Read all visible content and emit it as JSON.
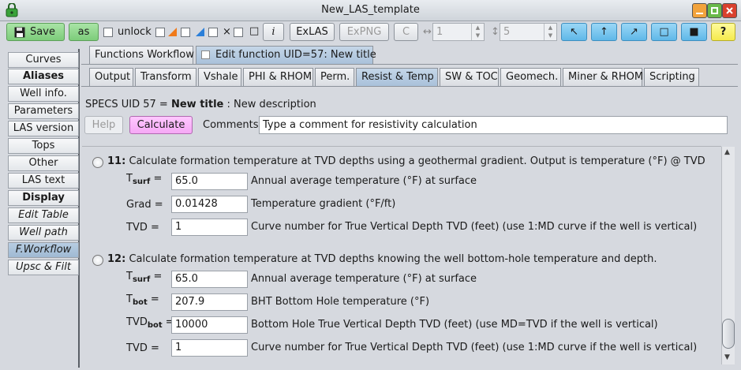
{
  "window": {
    "title": "New_LAS_template"
  },
  "toolbar": {
    "save_label": "Save",
    "as_label": "as",
    "unlock_label": "unlock",
    "x_label": "×",
    "info_label": "i",
    "exlas_label": "ExLAS",
    "expng_label": "ExPNG",
    "c_label": "C",
    "width_value": "1",
    "height_value": "5",
    "arrow_nw": "↖",
    "arrow_up": "↑",
    "arrow_ne": "↗",
    "square_outline": "□",
    "square_filled": "■",
    "help_q": "?"
  },
  "sidebar": {
    "items": [
      {
        "label": "Curves"
      },
      {
        "label": "Aliases"
      },
      {
        "label": "Well info."
      },
      {
        "label": "Parameters"
      },
      {
        "label": "LAS version"
      },
      {
        "label": "Tops"
      },
      {
        "label": "Other"
      },
      {
        "label": "LAS text"
      },
      {
        "label": "Display"
      },
      {
        "label": "Edit Table"
      },
      {
        "label": "Well path"
      },
      {
        "label": "F.Workflow"
      },
      {
        "label": "Upsc & Filt"
      }
    ]
  },
  "tabs_top": [
    {
      "label": "Functions Workflow"
    },
    {
      "label": "Edit function UID=57: New title"
    }
  ],
  "tabs_func": [
    {
      "label": "Output"
    },
    {
      "label": "Transform"
    },
    {
      "label": "Vshale"
    },
    {
      "label": "PHI & RHOM"
    },
    {
      "label": "Perm."
    },
    {
      "label": "Resist & Temp"
    },
    {
      "label": "SW & TOC"
    },
    {
      "label": "Geomech."
    },
    {
      "label": "Miner & RHOM"
    },
    {
      "label": "Scripting"
    }
  ],
  "specs": {
    "prefix": "SPECS UID 57 = ",
    "title": "New title",
    "desc": " : New description"
  },
  "actions": {
    "help": "Help",
    "calculate": "Calculate",
    "comments_label": "Comments:",
    "comments_value": "Type a comment for resistivity calculation"
  },
  "option11": {
    "num": "11:",
    "text": "Calculate formation temperature at TVD depths using a geothermal gradient. Output is temperature (°F) @ TVD",
    "params": [
      {
        "label_main": "T",
        "label_sub": "surf",
        "label_tail": " =",
        "value": "65.0",
        "desc": "Annual average temperature (°F) at surface"
      },
      {
        "label_main": "Grad =",
        "label_sub": "",
        "label_tail": "",
        "value": "0.01428",
        "desc": "Temperature gradient (°F/ft)"
      },
      {
        "label_main": "TVD =",
        "label_sub": "",
        "label_tail": "",
        "value": "1",
        "desc": "Curve number for True Vertical Depth TVD (feet) (use 1:MD curve if the well is vertical)"
      }
    ]
  },
  "option12": {
    "num": "12:",
    "text": "Calculate formation temperature at TVD depths knowing the well bottom-hole temperature and depth.",
    "params": [
      {
        "label_main": "T",
        "label_sub": "surf",
        "label_tail": " =",
        "value": "65.0",
        "desc": "Annual average temperature (°F) at surface"
      },
      {
        "label_main": "T",
        "label_sub": "bot",
        "label_tail": " =",
        "value": "207.9",
        "desc": "BHT Bottom Hole temperature (°F)"
      },
      {
        "label_main": "TVD",
        "label_sub": "bot",
        "label_tail": " =",
        "value": "10000",
        "desc": "Bottom Hole True Vertical Depth TVD (feet) (use MD=TVD if the well is vertical)"
      },
      {
        "label_main": "TVD =",
        "label_sub": "",
        "label_tail": "",
        "value": "1",
        "desc": "Curve number for True Vertical Depth TVD (feet) (use 1:MD curve if the well is vertical)"
      }
    ]
  },
  "colors": {
    "calculate": "#f5a8f5",
    "save": "#7dcc7a",
    "arrow_buttons": "#5fb8e8",
    "help_button": "#f5ea4c",
    "selected_tab": "#a9c1da"
  }
}
